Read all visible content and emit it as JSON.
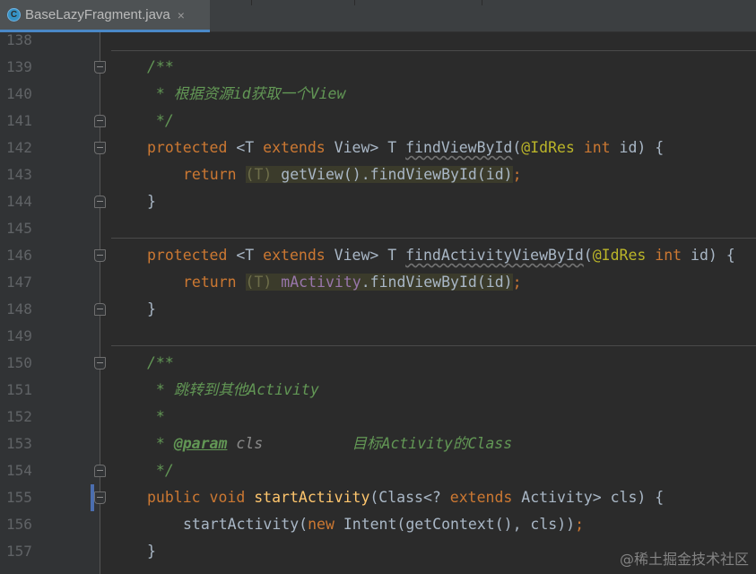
{
  "tab": {
    "title": "BaseLazyFragment.java",
    "icon": "C",
    "close": "×"
  },
  "lines": {
    "l138": {
      "num": "138"
    },
    "l139": {
      "num": "139",
      "c1": "/**"
    },
    "l140": {
      "num": "140",
      "c1": " * 根据资源id获取一个View"
    },
    "l141": {
      "num": "141",
      "c1": " */"
    },
    "l142": {
      "num": "142",
      "t1": "protected",
      "t2": " <T ",
      "t3": "extends",
      "t4": " View> T ",
      "t5": "findViewById",
      "t6": "(",
      "t7": "@IdRes",
      "t8": " ",
      "t9": "int",
      "t10": " id) {"
    },
    "l143": {
      "num": "143",
      "t1": "return",
      "t2": " ",
      "t3": "(T)",
      "t4": " getView().findViewById(id)",
      "t5": ";"
    },
    "l144": {
      "num": "144",
      "t1": "}"
    },
    "l145": {
      "num": "145"
    },
    "l146": {
      "num": "146",
      "t1": "protected",
      "t2": " <T ",
      "t3": "extends",
      "t4": " View> T ",
      "t5": "findActivityViewById",
      "t6": "(",
      "t7": "@IdRes",
      "t8": " ",
      "t9": "int",
      "t10": " id) {"
    },
    "l147": {
      "num": "147",
      "t1": "return",
      "t2": " ",
      "t3": "(T)",
      "t4": " mActivity",
      "t5": ".findViewById(id)",
      "t6": ";"
    },
    "l148": {
      "num": "148",
      "t1": "}"
    },
    "l149": {
      "num": "149"
    },
    "l150": {
      "num": "150",
      "c1": "/**"
    },
    "l151": {
      "num": "151",
      "c1": " * 跳转到其他Activity"
    },
    "l152": {
      "num": "152",
      "c1": " *"
    },
    "l153": {
      "num": "153",
      "c1": " * ",
      "c2": "@param",
      "c3": " cls",
      "c4": "          目标Activity的Class"
    },
    "l154": {
      "num": "154",
      "c1": " */"
    },
    "l155": {
      "num": "155",
      "t1": "public",
      "t2": " ",
      "t3": "void",
      "t4": " ",
      "t5": "startActivity",
      "t6": "(Class<? ",
      "t7": "extends",
      "t8": " Activity> cls) {"
    },
    "l156": {
      "num": "156",
      "t1": "startActivity(",
      "t2": "new",
      "t3": " Intent(getContext(), cls))",
      "t4": ";"
    },
    "l157": {
      "num": "157",
      "t1": "}"
    }
  },
  "watermark": "@稀土掘金技术社区"
}
